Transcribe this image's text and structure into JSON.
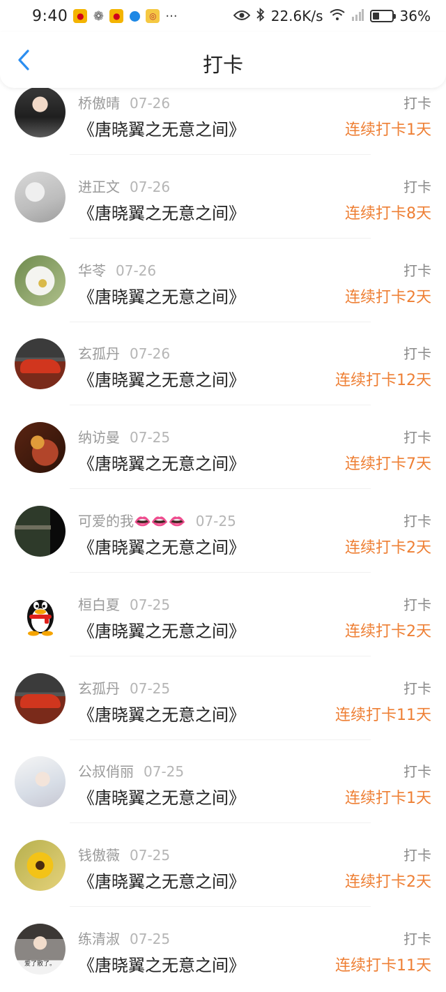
{
  "status_bar": {
    "time": "9:40",
    "more": "···",
    "network_speed": "22.6K/s",
    "battery_percent": "36%",
    "battery_level": 0.36,
    "icons": [
      "weibo-icon",
      "wechat-icon",
      "weibo-icon",
      "browser-icon",
      "music-icon",
      "eye-icon",
      "bluetooth-icon",
      "wifi-icon",
      "signal-icon",
      "battery-icon"
    ]
  },
  "header": {
    "title": "打卡",
    "back_icon": "chevron-left-icon"
  },
  "colors": {
    "accent_blue": "#2b8ef0",
    "streak_orange": "#ee7f34",
    "meta_gray": "#9a9a9a"
  },
  "checkins": [
    {
      "name": "桥傲晴",
      "date": "07-26",
      "book": "《唐晓翼之无意之间》",
      "tag": "打卡",
      "streak": "连续打卡1天"
    },
    {
      "name": "进正文",
      "date": "07-26",
      "book": "《唐晓翼之无意之间》",
      "tag": "打卡",
      "streak": "连续打卡8天"
    },
    {
      "name": "华苓",
      "date": "07-26",
      "book": "《唐晓翼之无意之间》",
      "tag": "打卡",
      "streak": "连续打卡2天"
    },
    {
      "name": "玄孤丹",
      "date": "07-26",
      "book": "《唐晓翼之无意之间》",
      "tag": "打卡",
      "streak": "连续打卡12天"
    },
    {
      "name": "纳访曼",
      "date": "07-25",
      "book": "《唐晓翼之无意之间》",
      "tag": "打卡",
      "streak": "连续打卡7天"
    },
    {
      "name": "可爱的我👄👄👄",
      "date": "07-25",
      "book": "《唐晓翼之无意之间》",
      "tag": "打卡",
      "streak": "连续打卡2天"
    },
    {
      "name": "桓白夏",
      "date": "07-25",
      "book": "《唐晓翼之无意之间》",
      "tag": "打卡",
      "streak": "连续打卡2天"
    },
    {
      "name": "玄孤丹",
      "date": "07-25",
      "book": "《唐晓翼之无意之间》",
      "tag": "打卡",
      "streak": "连续打卡11天"
    },
    {
      "name": "公叔俏丽",
      "date": "07-25",
      "book": "《唐晓翼之无意之间》",
      "tag": "打卡",
      "streak": "连续打卡1天"
    },
    {
      "name": "钱傲薇",
      "date": "07-25",
      "book": "《唐晓翼之无意之间》",
      "tag": "打卡",
      "streak": "连续打卡2天"
    },
    {
      "name": "练清淑",
      "date": "07-25",
      "book": "《唐晓翼之无意之间》",
      "tag": "打卡",
      "streak": "连续打卡11天",
      "avatar_caption": "爱了散了。"
    }
  ]
}
